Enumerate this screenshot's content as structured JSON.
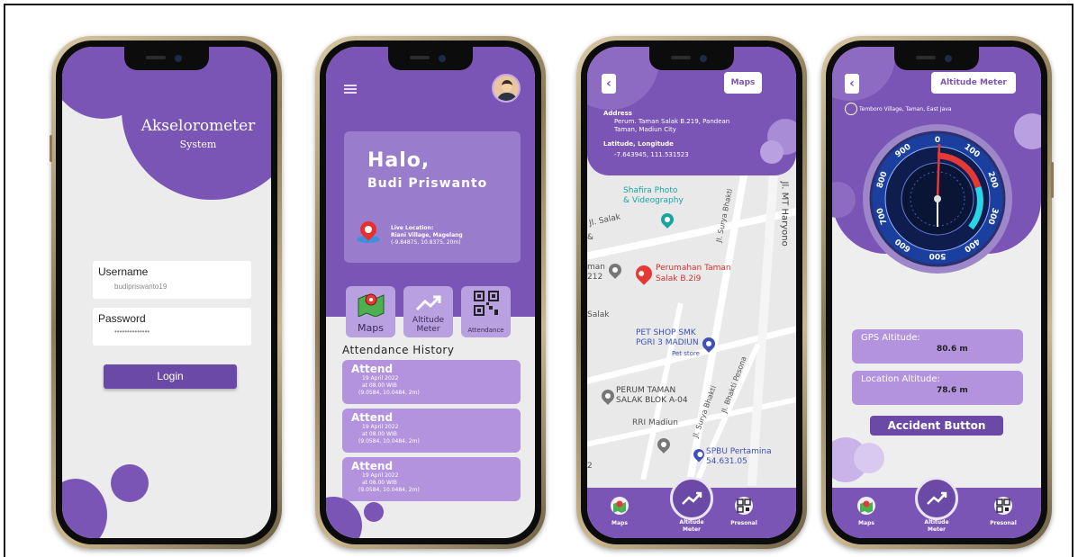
{
  "login": {
    "title": "Akselorometer",
    "subtitle": "System",
    "username_label": "Username",
    "username_value": "budipriswanto19",
    "password_label": "Password",
    "password_value": "••••••••••••••",
    "login_button": "Login"
  },
  "home": {
    "greeting": "Halo,",
    "name": "Budi Priswanto",
    "live_location_label": "Live Location:",
    "live_location_place": "Riani Village, Magelang",
    "live_location_coords": "(-9.84875, 10.8375, 20m)",
    "menu": [
      {
        "label": "Maps",
        "icon": "map-icon"
      },
      {
        "label": "Altitude Meter",
        "icon": "trend-icon"
      },
      {
        "label": "Attendance",
        "icon": "qr-icon"
      }
    ],
    "attendance_title": "Attendance History",
    "attendance": [
      {
        "status": "Attend",
        "date": "19 April 2022",
        "time": "at 08.00 WIB",
        "coords": "(9.0584, 10.0484, 2m)"
      },
      {
        "status": "Attend",
        "date": "19 April 2022",
        "time": "at 08.00 WIB",
        "coords": "(9.0584, 10.0484, 2m)"
      },
      {
        "status": "Attend",
        "date": "19 April 2022",
        "time": "at 08.00 WIB",
        "coords": "(9.0584, 10.0484, 2m)"
      }
    ]
  },
  "maps": {
    "title": "Maps",
    "address_label": "Address",
    "address_line1": "Perum. Taman Salak B.219, Pandean",
    "address_line2": "Taman, Madiun City",
    "latlon_label": "Latitude, Longitude",
    "latlon_value": "-7.643945, 111.531523",
    "places": {
      "shafira": "Shafira Photo",
      "shafira2": "& Videography",
      "salak": "Jl. Salak",
      "surya": "Jl. Surya Bhakti",
      "mt": "Jl. MT Haryono",
      "perumahan": "Perumahan Taman",
      "perumahan2": "Salak B.2i9",
      "petshop": "PET SHOP SMK",
      "petshop2": "PGRI 3 MADIUN",
      "petstore": "Pet store",
      "perum": "PERUM TAMAN",
      "perum2": "SALAK BLOK A-04",
      "rri": "RRI Madiun",
      "spbu": "SPBU Pertamina",
      "spbu2": "54.631.05",
      "pesona": "Jl. Bhakti Pesona",
      "man": "man",
      "n212": "212",
      "salak2": "Salak",
      "two": "2",
      "and": "&"
    }
  },
  "altitude": {
    "title": "Altitude Meter",
    "location": "Temboro Village, Taman, East Java",
    "gps_label": "GPS Altitude:",
    "gps_value": "80.6 m",
    "loc_label": "Location Altitude:",
    "loc_value": "78.6 m",
    "accident_button": "Accident Button",
    "dial": [
      "0",
      "100",
      "200",
      "300",
      "400",
      "500",
      "600",
      "700",
      "800",
      "900"
    ]
  },
  "nav": {
    "maps": "Maps",
    "altitude1": "Altitude",
    "altitude2": "Meter",
    "personal": "Presonal"
  },
  "colors": {
    "primary": "#7b55b5",
    "primary_dark": "#6b49a6",
    "card": "#b393dd",
    "gauge_blue": "#1f4db3"
  }
}
